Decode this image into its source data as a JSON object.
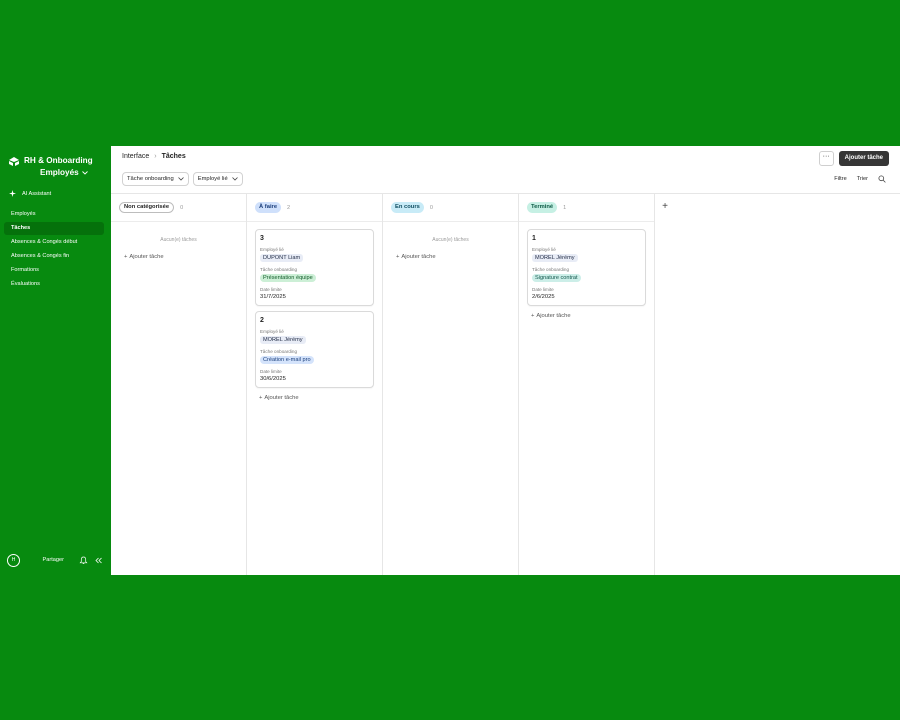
{
  "colors": {
    "sidebar": "#078a0f",
    "active_nav": "#05710b",
    "primary_button": "#363636"
  },
  "sidebar": {
    "base_name": "RH & Onboarding",
    "table_name": "Employés",
    "ai_label": "AI Assistant",
    "items": [
      {
        "label": "Employés",
        "active": false
      },
      {
        "label": "Tâches",
        "active": true
      },
      {
        "label": "Absences & Congés début",
        "active": false
      },
      {
        "label": "Absences & Congés fin",
        "active": false
      },
      {
        "label": "Formations",
        "active": false
      },
      {
        "label": "Évaluations",
        "active": false
      }
    ],
    "avatar_initial": "H",
    "share_label": "Partager",
    "icons": [
      "logo-icon",
      "sparkle-icon",
      "bell-icon",
      "collapse-icon"
    ]
  },
  "header": {
    "breadcrumb_root": "Interface",
    "breadcrumb_current": "Tâches",
    "more_label": "···",
    "add_button": "Ajouter tâche"
  },
  "filters": [
    {
      "label": "Tâche onboarding"
    },
    {
      "label": "Employé lié"
    }
  ],
  "view_actions": {
    "filter": "Filtre",
    "sort": "Trier"
  },
  "columns": [
    {
      "label": "Non catégorisée",
      "count": "0",
      "empty_text": "Aucun(e) tâches",
      "add_label": "Ajouter tâche"
    },
    {
      "label": "À faire",
      "count": "2",
      "add_label": "Ajouter tâche"
    },
    {
      "label": "En cours",
      "count": "0",
      "empty_text": "Aucun(e) tâches",
      "add_label": "Ajouter tâche"
    },
    {
      "label": "Terminé",
      "count": "1",
      "add_label": "Ajouter tâche"
    }
  ],
  "field_labels": {
    "employee": "Employé lié",
    "task": "Tâche onboarding",
    "due": "Date limite"
  },
  "cards": {
    "todo": [
      {
        "id": "3",
        "employee": "DUPONT Liam",
        "task": "Présentation équipe",
        "due": "31/7/2025"
      },
      {
        "id": "2",
        "employee": "MOREL Jérémy",
        "task": "Création e-mail pro",
        "due": "30/6/2025"
      }
    ],
    "done": [
      {
        "id": "1",
        "employee": "MOREL Jérémy",
        "task": "Signature contrat",
        "due": "2/6/2025"
      }
    ]
  },
  "add_column_label": "+"
}
